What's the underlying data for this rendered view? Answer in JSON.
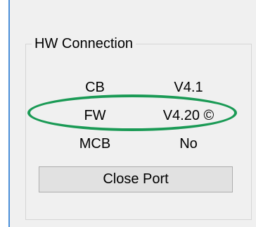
{
  "group": {
    "title": "HW Connection",
    "rows": [
      {
        "label": "CB",
        "value": "V4.1"
      },
      {
        "label": "FW",
        "value": "V4.20 ©"
      },
      {
        "label": "MCB",
        "value": "No"
      }
    ],
    "button_label": "Close Port"
  },
  "colors": {
    "highlight": "#1a9a55",
    "window_edge": "#4a8fd8",
    "panel": "#f0f0f0"
  }
}
